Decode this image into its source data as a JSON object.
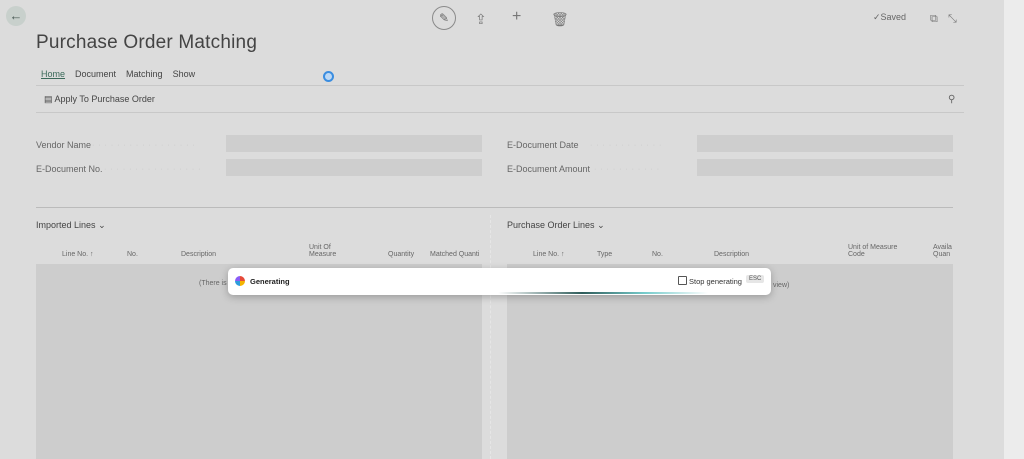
{
  "top": {
    "back_icon": "arrow-left-icon",
    "saved_label": "Saved"
  },
  "page": {
    "title": "Purchase Order Matching",
    "tabs": [
      "Home",
      "Document",
      "Matching",
      "Show"
    ],
    "action_label": "Apply To Purchase Order"
  },
  "fields": {
    "vendor_name": "Vendor Name",
    "edocument_no": "E-Document No.",
    "edocument_date": "E-Document Date",
    "edocument_amount": "E-Document Amount"
  },
  "imported": {
    "title": "Imported Lines",
    "columns": [
      "Line No. ↑",
      "No.",
      "Description",
      "Unit Of Measure",
      "Quantity",
      "Matched Quanti"
    ],
    "empty_text": "(There is"
  },
  "po": {
    "title": "Purchase Order Lines",
    "columns": [
      "Line No. ↑",
      "Type",
      "No.",
      "Description",
      "Unit of Measure Code",
      "Availa Quan"
    ],
    "empty_text": "view)"
  },
  "overlay": {
    "status": "Generating",
    "stop_label": "Stop generating",
    "esc_label": "ESC"
  }
}
